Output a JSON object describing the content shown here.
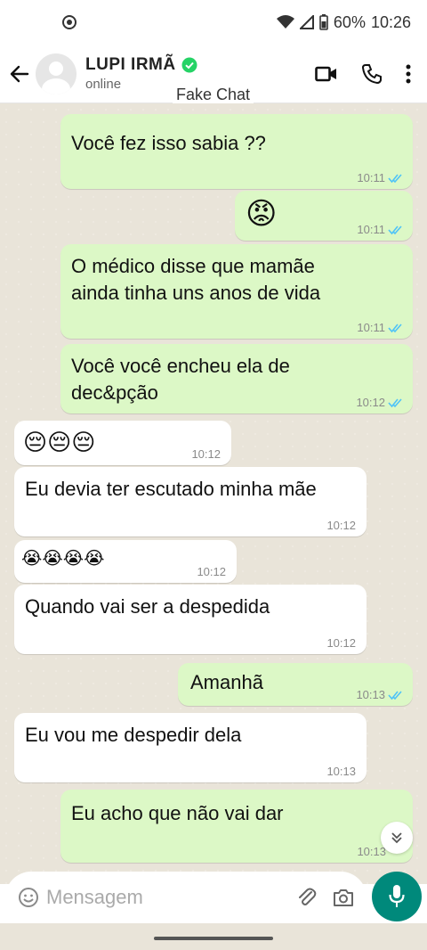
{
  "status_bar": {
    "battery": "60%",
    "time": "10:26"
  },
  "header": {
    "contact_name": "LUPI IRMÃ",
    "contact_status": "online",
    "fake_tag": "Fake Chat"
  },
  "messages": [
    {
      "direction": "out",
      "text": "Você fez isso sabia ??",
      "time": "10:11",
      "read": true
    },
    {
      "direction": "out",
      "emoji": "😡",
      "time": "10:11",
      "read": true
    },
    {
      "direction": "out",
      "line1": "O médico disse que mamãe",
      "line2": "ainda tinha uns anos de vida",
      "time": "10:11",
      "read": true
    },
    {
      "direction": "out",
      "line1": "Você você encheu ela de",
      "line2": "dec&pção",
      "time": "10:12",
      "read": true
    },
    {
      "direction": "in",
      "emoji": "😔😔😔",
      "time": "10:12"
    },
    {
      "direction": "in",
      "text": "Eu devia ter escutado minha mãe",
      "time": "10:12"
    },
    {
      "direction": "in",
      "emoji": "😭😭😭😭",
      "time": "10:12"
    },
    {
      "direction": "in",
      "text": "Quando vai ser a despedida",
      "time": "10:12"
    },
    {
      "direction": "out",
      "text": "Amanhã",
      "time": "10:13",
      "read": true
    },
    {
      "direction": "in",
      "text": "Eu vou me despedir dela",
      "time": "10:13"
    },
    {
      "direction": "out",
      "text": "Eu acho que não vai dar",
      "time": "10:13"
    }
  ],
  "input": {
    "placeholder": "Mensagem"
  },
  "colors": {
    "outgoing_bubble": "#dcf8c6",
    "incoming_bubble": "#ffffff",
    "chat_background": "#e9e4d9",
    "accent": "#00897b",
    "read_tick": "#4fc3f7",
    "verified": "#25d366"
  },
  "icons": [
    "back-arrow-icon",
    "verified-icon",
    "video-call-icon",
    "phone-icon",
    "more-icon",
    "emoji-icon",
    "attach-icon",
    "camera-icon",
    "mic-icon",
    "scroll-down-icon",
    "read-ticks-icon"
  ]
}
